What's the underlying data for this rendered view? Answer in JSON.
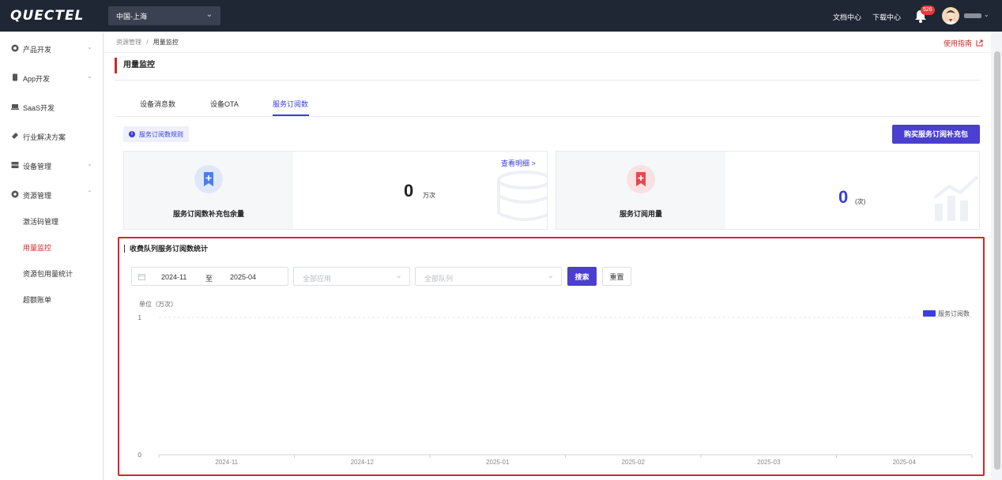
{
  "topbar": {
    "logo": "QUECTEL",
    "region": "中国-上海",
    "links": [
      "文档中心",
      "下载中心"
    ],
    "notification_count": "526"
  },
  "sidebar": {
    "items": [
      {
        "label": "产品开发",
        "icon": "cube-icon",
        "expandable": true
      },
      {
        "label": "App开发",
        "icon": "phone-icon",
        "expandable": true
      },
      {
        "label": "SaaS开发",
        "icon": "laptop-icon",
        "expandable": false
      },
      {
        "label": "行业解决方案",
        "icon": "layers-icon",
        "expandable": false
      },
      {
        "label": "设备管理",
        "icon": "server-icon",
        "expandable": true
      },
      {
        "label": "资源管理",
        "icon": "gear-icon",
        "expandable": true,
        "expanded": true
      }
    ],
    "subitems": [
      {
        "label": "激活码管理",
        "active": false
      },
      {
        "label": "用量监控",
        "active": true
      },
      {
        "label": "资源包用量统计",
        "active": false
      },
      {
        "label": "超额账单",
        "active": false
      }
    ]
  },
  "breadcrumb": {
    "parent": "资源管理",
    "separator": "/",
    "current": "用量监控"
  },
  "guide_link": "使用指南",
  "page_title": "用量监控",
  "tabs": [
    {
      "label": "设备消息数",
      "active": false
    },
    {
      "label": "设备OTA",
      "active": false
    },
    {
      "label": "服务订阅数",
      "active": true
    }
  ],
  "rule_tag": "服务订阅数规则",
  "buy_button": "购买服务订阅补充包",
  "cards": [
    {
      "label": "服务订阅数补充包余量",
      "value": "0",
      "unit": "万次",
      "link": "查看明细 >"
    },
    {
      "label": "服务订阅用量",
      "value": "0",
      "unit": "(次)"
    }
  ],
  "stats": {
    "title": "收费队列服务订阅数统计",
    "date_start": "2024-11",
    "date_separator": "至",
    "date_end": "2025-04",
    "app_placeholder": "全部应用",
    "queue_placeholder": "全部队列",
    "search_label": "搜索",
    "reset_label": "重置"
  },
  "colors": {
    "accent": "#4b3fcf",
    "brand_red": "#c92a2a",
    "highlight_border": "#d9232a"
  },
  "chart_data": {
    "type": "bar",
    "ylabel": "单位（万次）",
    "ylim": [
      0,
      1
    ],
    "yticks": [
      "1",
      "0"
    ],
    "categories": [
      "2024-11",
      "2024-12",
      "2025-01",
      "2025-02",
      "2025-03",
      "2025-04"
    ],
    "series": [
      {
        "name": "服务订阅数",
        "values": [
          0,
          0,
          0,
          0,
          0,
          0
        ],
        "color": "#3c3fe0"
      }
    ],
    "grid": true,
    "legend": "top-right"
  }
}
